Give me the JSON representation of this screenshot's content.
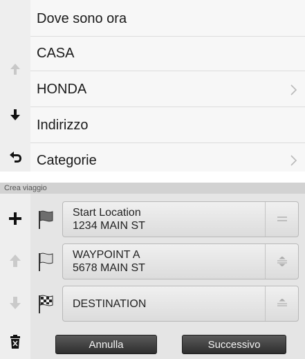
{
  "top_menu": {
    "items": [
      {
        "label": "Dove sono ora",
        "has_chevron": false
      },
      {
        "label": "CASA",
        "has_chevron": false
      },
      {
        "label": "HONDA",
        "has_chevron": true
      },
      {
        "label": "Indirizzo",
        "has_chevron": false
      },
      {
        "label": "Categorie",
        "has_chevron": true
      }
    ],
    "rail_icons": [
      "scroll-up-icon",
      "scroll-down-icon",
      "back-icon"
    ]
  },
  "trip": {
    "title": "Crea viaggio",
    "stops": [
      {
        "name": "Start Location",
        "address": "1234 MAIN ST",
        "flag": "start-flag-icon"
      },
      {
        "name": "WAYPOINT A",
        "address": "5678 MAIN ST",
        "flag": "waypoint-flag-icon"
      },
      {
        "name": "DESTINATION",
        "address": "",
        "flag": "destination-flag-icon"
      }
    ],
    "cancel_label": "Annulla",
    "next_label": "Successivo",
    "rail_icons": [
      "add-icon",
      "move-up-icon",
      "move-down-icon",
      "delete-icon"
    ]
  },
  "colors": {
    "button_dark": "#3a3a3a",
    "list_bg": "#f7f7f7",
    "rail_bg": "#eeeeee"
  }
}
